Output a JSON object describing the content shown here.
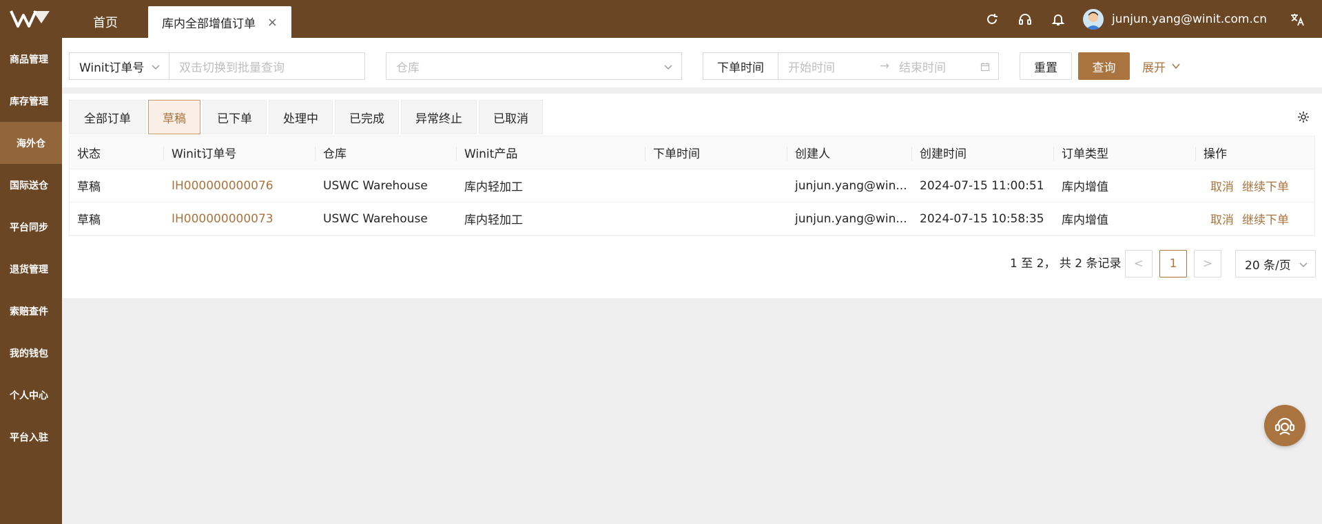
{
  "topbar": {
    "tabs": [
      {
        "label": "首页"
      },
      {
        "label": "库内全部增值订单",
        "close": "×"
      }
    ],
    "user_email": "junjun.yang@winit.com.cn",
    "icons": [
      "refresh-icon",
      "headset-icon",
      "bell-icon",
      "avatar",
      "translate-icon"
    ]
  },
  "sidebar": {
    "items": [
      {
        "label": "商品管理"
      },
      {
        "label": "库存管理"
      },
      {
        "label": "海外仓",
        "active": true
      },
      {
        "label": "国际送仓"
      },
      {
        "label": "平台同步"
      },
      {
        "label": "退货管理"
      },
      {
        "label": "索赔查件"
      },
      {
        "label": "我的钱包"
      },
      {
        "label": "个人中心"
      },
      {
        "label": "平台入驻"
      }
    ]
  },
  "filters": {
    "order_type_select": "Winit订单号",
    "order_input_placeholder": "双击切换到批量查询",
    "warehouse_placeholder": "仓库",
    "time_type": "下单时间",
    "start_placeholder": "开始时间",
    "arrow": "→",
    "end_placeholder": "结束时间",
    "reset": "重置",
    "query": "查询",
    "expand": "展开"
  },
  "status_tabs": [
    {
      "label": "全部订单"
    },
    {
      "label": "草稿",
      "active": true
    },
    {
      "label": "已下单"
    },
    {
      "label": "处理中"
    },
    {
      "label": "已完成"
    },
    {
      "label": "异常终止"
    },
    {
      "label": "已取消"
    }
  ],
  "table": {
    "headers": [
      "状态",
      "Winit订单号",
      "仓库",
      "Winit产品",
      "下单时间",
      "创建人",
      "创建时间",
      "订单类型",
      "操作"
    ],
    "rows": [
      {
        "status": "草稿",
        "order_no": "IH000000000076",
        "warehouse": "USWC Warehouse",
        "product": "库内轻加工",
        "order_time": "",
        "creator": "junjun.yang@win...",
        "created": "2024-07-15 11:00:51",
        "type": "库内增值",
        "ops": [
          "取消",
          "继续下单"
        ]
      },
      {
        "status": "草稿",
        "order_no": "IH000000000073",
        "warehouse": "USWC Warehouse",
        "product": "库内轻加工",
        "order_time": "",
        "creator": "junjun.yang@win...",
        "created": "2024-07-15 10:58:35",
        "type": "库内增值",
        "ops": [
          "取消",
          "继续下单"
        ]
      }
    ]
  },
  "pagination": {
    "summary": "1 至 2， 共 2 条记录",
    "prev": "<",
    "current": "1",
    "next": ">",
    "page_size": "20 条/页"
  },
  "colors": {
    "brand": "#6b4625",
    "accent": "#a9743f"
  }
}
